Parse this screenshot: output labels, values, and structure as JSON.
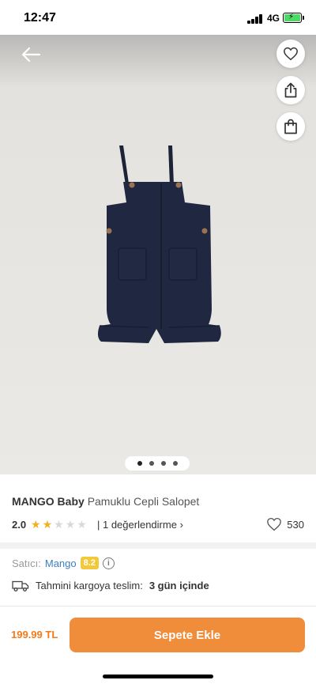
{
  "status_bar": {
    "time": "12:47",
    "network": "4G"
  },
  "product": {
    "brand": "MANGO Baby",
    "name": "Pamuklu Cepli Salopet",
    "rating": "2.0",
    "stars_filled": 2,
    "stars_total": 5,
    "review_link": "| 1 değerlendirme",
    "favorite_count": "530",
    "image_count": 4,
    "active_image": 1
  },
  "seller": {
    "label": "Satıcı:",
    "name": "Mango",
    "score": "8.2"
  },
  "shipping": {
    "label": "Tahmini kargoya teslim:",
    "value": "3 gün içinde"
  },
  "footer": {
    "price": "199.99 TL",
    "add_to_cart": "Sepete Ekle"
  },
  "colors": {
    "accent": "#f27a1a",
    "button": "#f08d3a",
    "star": "#f2b01e",
    "seller_link": "#3b7fc4",
    "score_badge": "#f2c93a"
  }
}
